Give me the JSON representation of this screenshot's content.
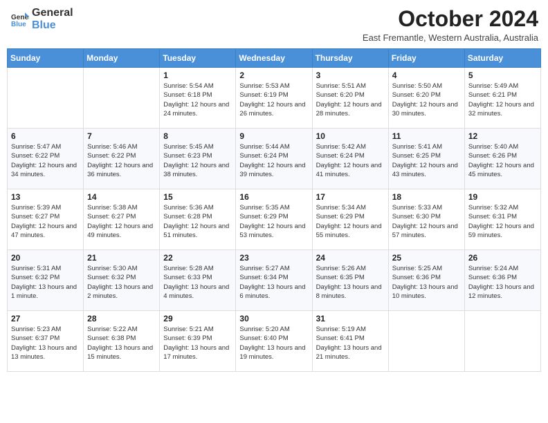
{
  "logo": {
    "general": "General",
    "blue": "Blue"
  },
  "title": "October 2024",
  "subtitle": "East Fremantle, Western Australia, Australia",
  "days_of_week": [
    "Sunday",
    "Monday",
    "Tuesday",
    "Wednesday",
    "Thursday",
    "Friday",
    "Saturday"
  ],
  "weeks": [
    [
      {
        "day": "",
        "info": ""
      },
      {
        "day": "",
        "info": ""
      },
      {
        "day": "1",
        "info": "Sunrise: 5:54 AM\nSunset: 6:18 PM\nDaylight: 12 hours and 24 minutes."
      },
      {
        "day": "2",
        "info": "Sunrise: 5:53 AM\nSunset: 6:19 PM\nDaylight: 12 hours and 26 minutes."
      },
      {
        "day": "3",
        "info": "Sunrise: 5:51 AM\nSunset: 6:20 PM\nDaylight: 12 hours and 28 minutes."
      },
      {
        "day": "4",
        "info": "Sunrise: 5:50 AM\nSunset: 6:20 PM\nDaylight: 12 hours and 30 minutes."
      },
      {
        "day": "5",
        "info": "Sunrise: 5:49 AM\nSunset: 6:21 PM\nDaylight: 12 hours and 32 minutes."
      }
    ],
    [
      {
        "day": "6",
        "info": "Sunrise: 5:47 AM\nSunset: 6:22 PM\nDaylight: 12 hours and 34 minutes."
      },
      {
        "day": "7",
        "info": "Sunrise: 5:46 AM\nSunset: 6:22 PM\nDaylight: 12 hours and 36 minutes."
      },
      {
        "day": "8",
        "info": "Sunrise: 5:45 AM\nSunset: 6:23 PM\nDaylight: 12 hours and 38 minutes."
      },
      {
        "day": "9",
        "info": "Sunrise: 5:44 AM\nSunset: 6:24 PM\nDaylight: 12 hours and 39 minutes."
      },
      {
        "day": "10",
        "info": "Sunrise: 5:42 AM\nSunset: 6:24 PM\nDaylight: 12 hours and 41 minutes."
      },
      {
        "day": "11",
        "info": "Sunrise: 5:41 AM\nSunset: 6:25 PM\nDaylight: 12 hours and 43 minutes."
      },
      {
        "day": "12",
        "info": "Sunrise: 5:40 AM\nSunset: 6:26 PM\nDaylight: 12 hours and 45 minutes."
      }
    ],
    [
      {
        "day": "13",
        "info": "Sunrise: 5:39 AM\nSunset: 6:27 PM\nDaylight: 12 hours and 47 minutes."
      },
      {
        "day": "14",
        "info": "Sunrise: 5:38 AM\nSunset: 6:27 PM\nDaylight: 12 hours and 49 minutes."
      },
      {
        "day": "15",
        "info": "Sunrise: 5:36 AM\nSunset: 6:28 PM\nDaylight: 12 hours and 51 minutes."
      },
      {
        "day": "16",
        "info": "Sunrise: 5:35 AM\nSunset: 6:29 PM\nDaylight: 12 hours and 53 minutes."
      },
      {
        "day": "17",
        "info": "Sunrise: 5:34 AM\nSunset: 6:29 PM\nDaylight: 12 hours and 55 minutes."
      },
      {
        "day": "18",
        "info": "Sunrise: 5:33 AM\nSunset: 6:30 PM\nDaylight: 12 hours and 57 minutes."
      },
      {
        "day": "19",
        "info": "Sunrise: 5:32 AM\nSunset: 6:31 PM\nDaylight: 12 hours and 59 minutes."
      }
    ],
    [
      {
        "day": "20",
        "info": "Sunrise: 5:31 AM\nSunset: 6:32 PM\nDaylight: 13 hours and 1 minute."
      },
      {
        "day": "21",
        "info": "Sunrise: 5:30 AM\nSunset: 6:32 PM\nDaylight: 13 hours and 2 minutes."
      },
      {
        "day": "22",
        "info": "Sunrise: 5:28 AM\nSunset: 6:33 PM\nDaylight: 13 hours and 4 minutes."
      },
      {
        "day": "23",
        "info": "Sunrise: 5:27 AM\nSunset: 6:34 PM\nDaylight: 13 hours and 6 minutes."
      },
      {
        "day": "24",
        "info": "Sunrise: 5:26 AM\nSunset: 6:35 PM\nDaylight: 13 hours and 8 minutes."
      },
      {
        "day": "25",
        "info": "Sunrise: 5:25 AM\nSunset: 6:36 PM\nDaylight: 13 hours and 10 minutes."
      },
      {
        "day": "26",
        "info": "Sunrise: 5:24 AM\nSunset: 6:36 PM\nDaylight: 13 hours and 12 minutes."
      }
    ],
    [
      {
        "day": "27",
        "info": "Sunrise: 5:23 AM\nSunset: 6:37 PM\nDaylight: 13 hours and 13 minutes."
      },
      {
        "day": "28",
        "info": "Sunrise: 5:22 AM\nSunset: 6:38 PM\nDaylight: 13 hours and 15 minutes."
      },
      {
        "day": "29",
        "info": "Sunrise: 5:21 AM\nSunset: 6:39 PM\nDaylight: 13 hours and 17 minutes."
      },
      {
        "day": "30",
        "info": "Sunrise: 5:20 AM\nSunset: 6:40 PM\nDaylight: 13 hours and 19 minutes."
      },
      {
        "day": "31",
        "info": "Sunrise: 5:19 AM\nSunset: 6:41 PM\nDaylight: 13 hours and 21 minutes."
      },
      {
        "day": "",
        "info": ""
      },
      {
        "day": "",
        "info": ""
      }
    ]
  ]
}
